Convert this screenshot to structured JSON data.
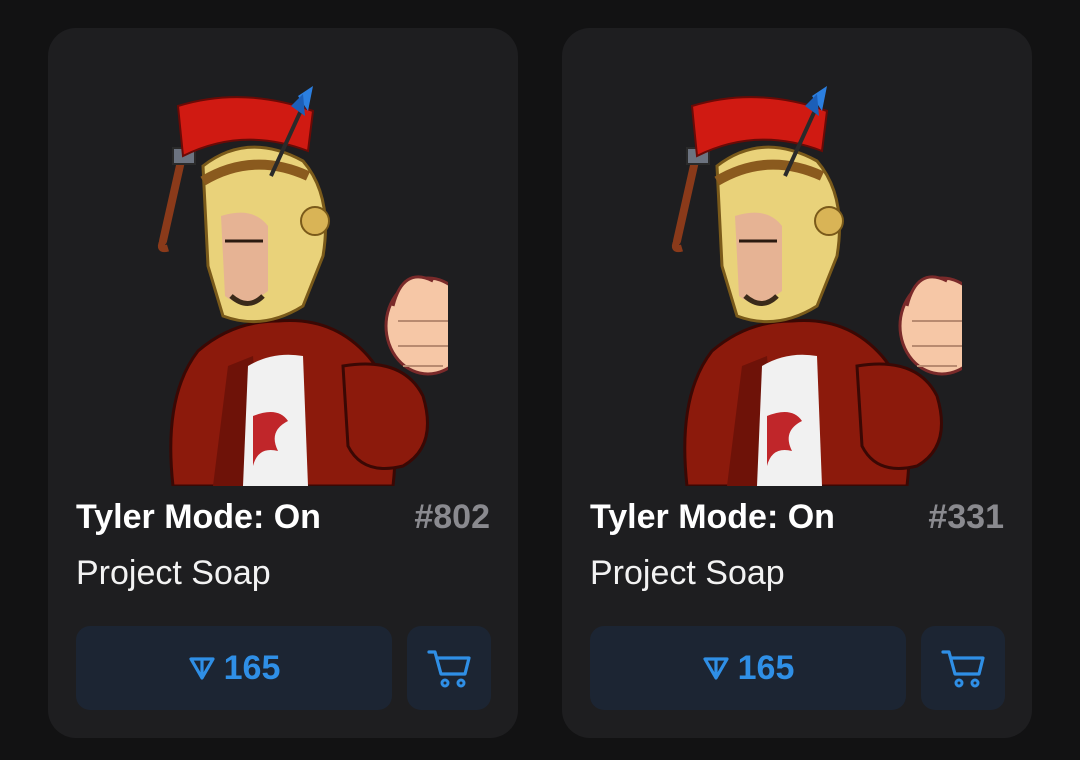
{
  "colors": {
    "page_bg": "#121213",
    "card_bg": "#1e1e20",
    "button_bg": "#1c2533",
    "accent": "#2f8fe6",
    "number": "#8a8a8f"
  },
  "cards": [
    {
      "title": "Tyler Mode: On",
      "number": "#802",
      "collection": "Project Soap",
      "price": "165",
      "currency_icon": "ton-icon",
      "cart_icon": "cart-icon"
    },
    {
      "title": "Tyler Mode: On",
      "number": "#331",
      "collection": "Project Soap",
      "price": "165",
      "currency_icon": "ton-icon",
      "cart_icon": "cart-icon"
    }
  ]
}
